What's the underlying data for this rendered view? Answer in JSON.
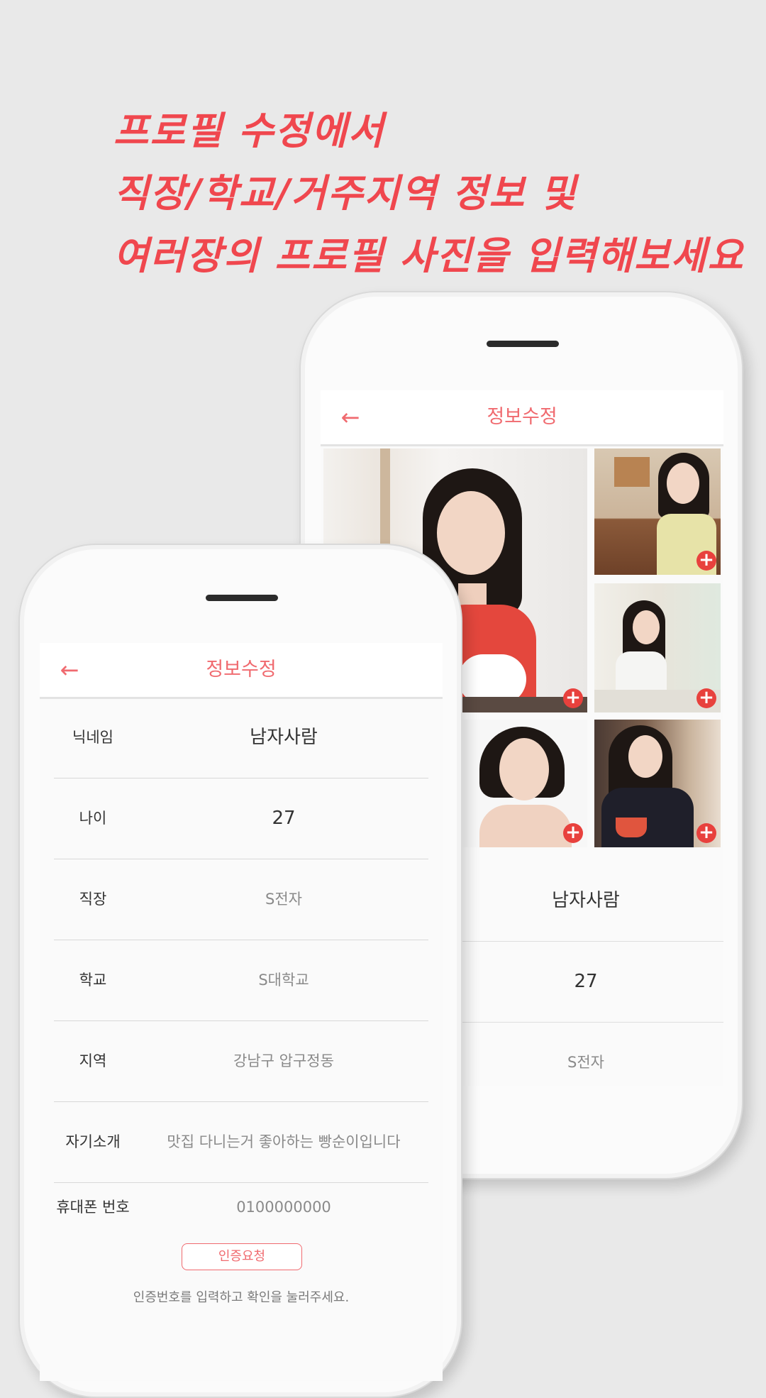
{
  "headline": {
    "line1": "프로필 수정에서",
    "line2": "직장/학교/거주지역 정보 및",
    "line3": "여러장의 프로필 사진을 입력해보세요"
  },
  "colors": {
    "accent": "#f06a6f",
    "headline": "#f0474e",
    "add_badge": "#e8413d"
  },
  "back_phone": {
    "title": "정보수정",
    "back_icon": "arrow-left-icon",
    "photos": [
      {
        "icon": "plus-icon",
        "badge": "+"
      },
      {
        "icon": "plus-icon",
        "badge": "+"
      },
      {
        "icon": "plus-icon",
        "badge": "+"
      },
      {
        "icon": "plus-icon",
        "badge": "+"
      },
      {
        "icon": "plus-icon",
        "badge": "+"
      }
    ],
    "nickname": "남자사람",
    "age": "27",
    "job": "S전자"
  },
  "front_phone": {
    "title": "정보수정",
    "back_icon": "arrow-left-icon",
    "fields": [
      {
        "label": "닉네임",
        "value": "남자사람"
      },
      {
        "label": "나이",
        "value": "27"
      },
      {
        "label": "직장",
        "value": "S전자"
      },
      {
        "label": "학교",
        "value": "S대학교"
      },
      {
        "label": "지역",
        "value": "강남구 압구정동"
      },
      {
        "label": "자기소개",
        "value": "맛집 다니는거 좋아하는 빵순이입니다"
      },
      {
        "label": "휴대폰 번호",
        "value": "0100000000"
      }
    ],
    "verify_button": "인증요청",
    "hint": "인증번호를 입력하고 확인을 눌러주세요."
  }
}
